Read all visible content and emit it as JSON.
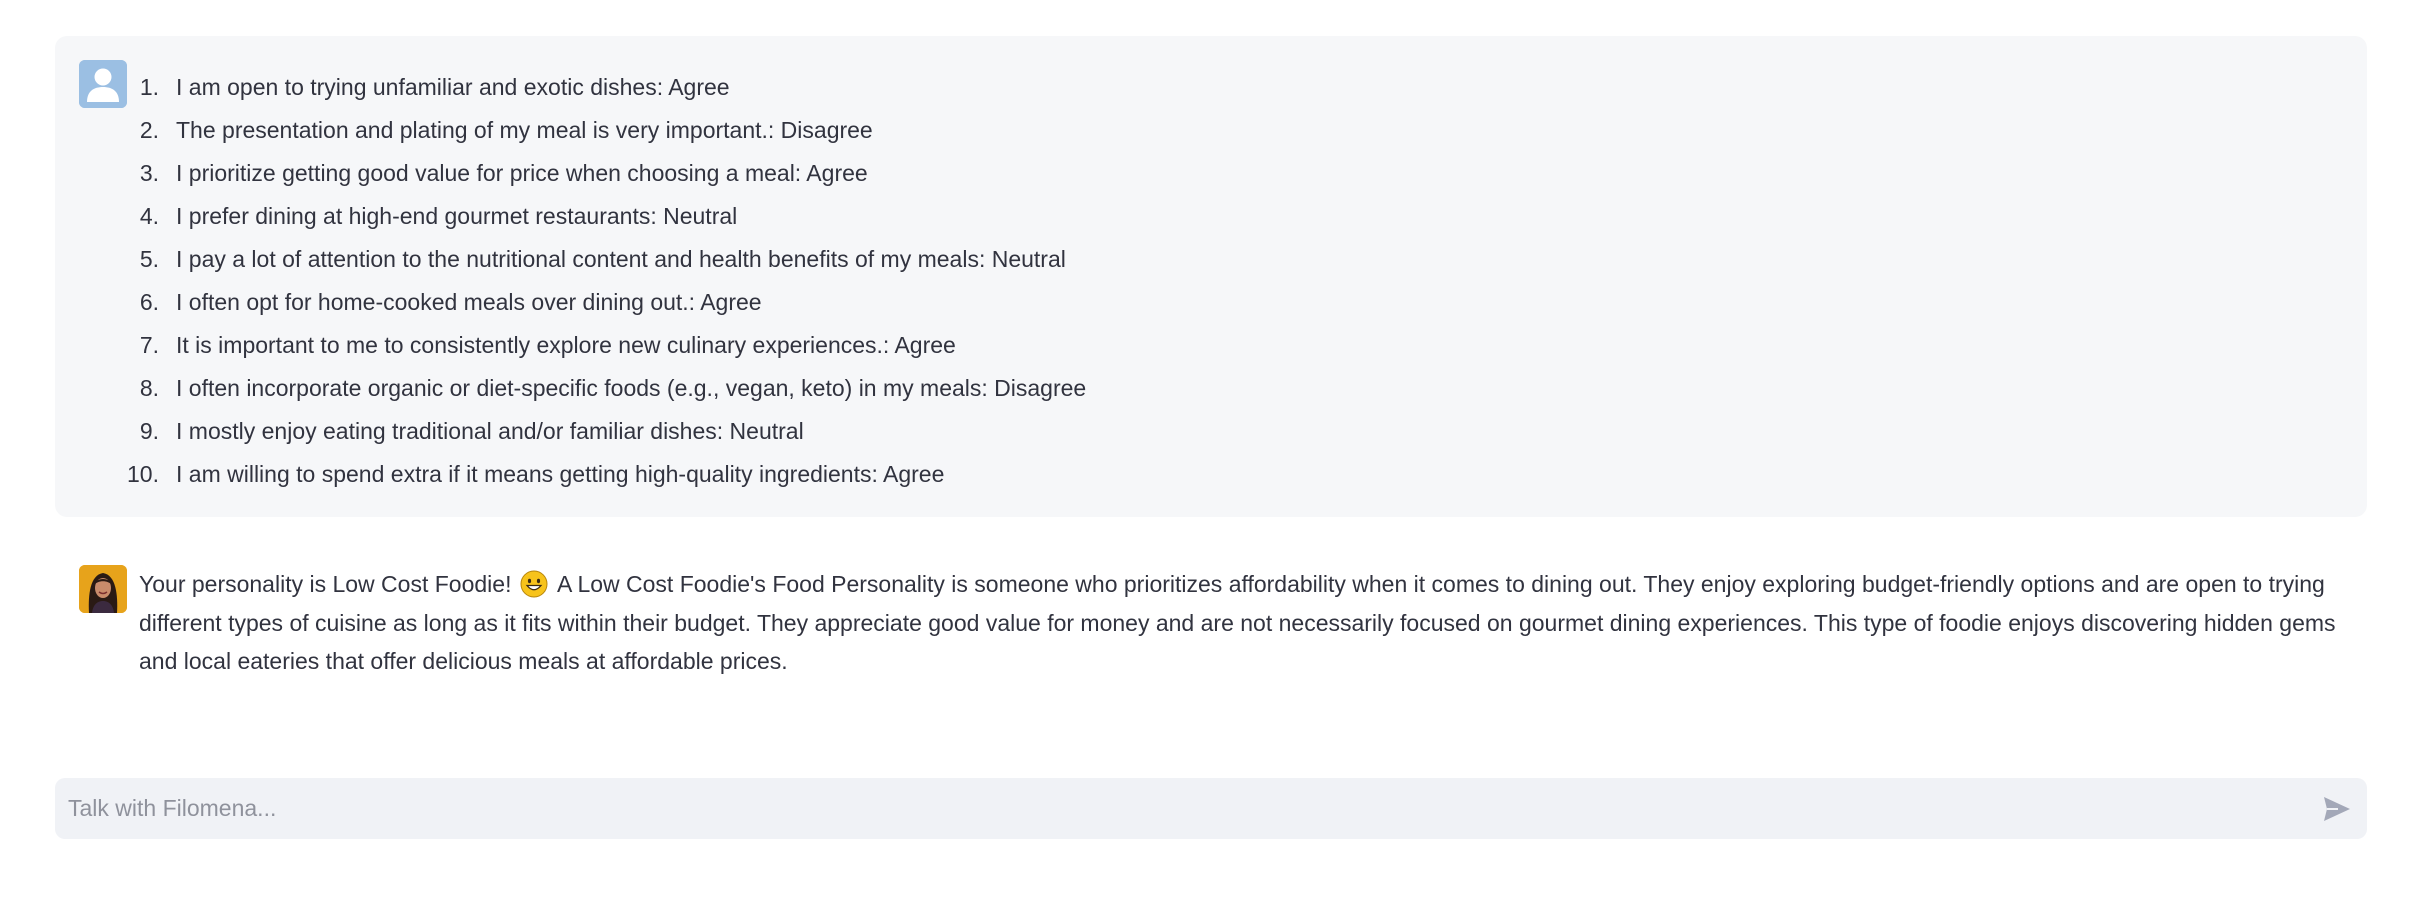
{
  "messages": {
    "user": {
      "avatar_icon": "user-silhouette-icon",
      "answers": [
        {
          "num": "1.",
          "text": "I am open to trying unfamiliar and exotic dishes: Agree"
        },
        {
          "num": "2.",
          "text": "The presentation and plating of my meal is very important.: Disagree"
        },
        {
          "num": "3.",
          "text": "I prioritize getting good value for price when choosing a meal: Agree"
        },
        {
          "num": "4.",
          "text": "I prefer dining at high-end gourmet restaurants: Neutral"
        },
        {
          "num": "5.",
          "text": "I pay a lot of attention to the nutritional content and health benefits of my meals: Neutral"
        },
        {
          "num": "6.",
          "text": "I often opt for home-cooked meals over dining out.: Agree"
        },
        {
          "num": "7.",
          "text": "It is important to me to consistently explore new culinary experiences.: Agree"
        },
        {
          "num": "8.",
          "text": "I often incorporate organic or diet-specific foods (e.g., vegan, keto) in my meals: Disagree"
        },
        {
          "num": "9.",
          "text": "I mostly enjoy eating traditional and/or familiar dishes: Neutral"
        },
        {
          "num": "10.",
          "text": "I am willing to spend extra if it means getting high-quality ingredients: Agree"
        }
      ]
    },
    "assistant": {
      "avatar_icon": "filomena-portrait-icon",
      "text_before_emoji": "Your personality is Low Cost Foodie!",
      "emoji_icon": "grinning-face-emoji-icon",
      "text_after_emoji": "A Low Cost Foodie's Food Personality is someone who prioritizes affordability when it comes to dining out. They enjoy exploring budget-friendly options and are open to trying different types of cuisine as long as it fits within their budget. They appreciate good value for money and are not necessarily focused on gourmet dining experiences. This type of foodie enjoys discovering hidden gems and local eateries that offer delicious meals at affordable prices."
    }
  },
  "chat_input": {
    "placeholder": "Talk with Filomena...",
    "value": "",
    "send_icon": "send-icon"
  },
  "colors": {
    "user_bubble_bg": "#f6f7f9",
    "input_bg": "#f0f2f6",
    "text": "#31333f",
    "placeholder": "#8f929c",
    "user_avatar_bg": "#9bbfe3"
  }
}
